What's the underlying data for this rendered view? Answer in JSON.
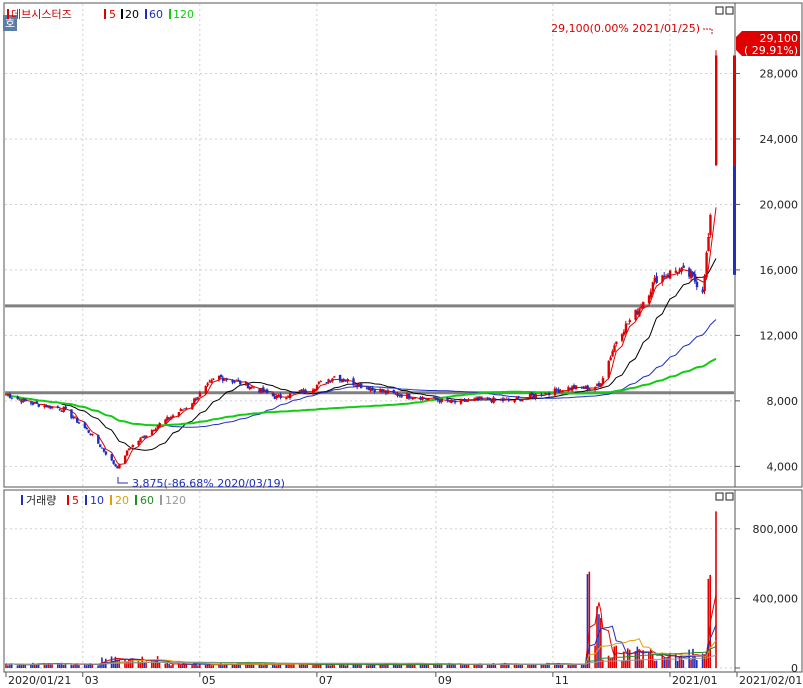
{
  "price_panel": {
    "title": "데브시스터즈",
    "ma_periods": [
      "5",
      "20",
      "60",
      "120"
    ],
    "ma_colors": [
      "#e00000",
      "#000000",
      "#1f2fbf",
      "#11cc11"
    ],
    "side_icon": "expand-icon",
    "max_annotation": "29,100(0.00% 2021/01/25)",
    "min_annotation": "3,875(-86.68% 2020/03/19)",
    "current_price": "29,100",
    "current_change": "( 29.91%)"
  },
  "volume_panel": {
    "title": "거래량",
    "ma_periods": [
      "5",
      "10",
      "20",
      "60",
      "120"
    ],
    "ma_colors": [
      "#e00000",
      "#1f2fbf",
      "#e0a000",
      "#228b22",
      "#999999"
    ]
  },
  "x_axis_labels": [
    "2020/01/21",
    "03",
    "05",
    "07",
    "09",
    "11",
    "2021/01",
    "2021/02/01"
  ],
  "chart_data": [
    {
      "type": "line",
      "title": "데브시스터즈",
      "y_ticks": [
        "4,000",
        "8,000",
        "12,000",
        "16,000",
        "20,000",
        "24,000",
        "28,000"
      ],
      "ylim": [
        2800,
        32000
      ],
      "x_start": "2020/01/21",
      "x_end": "2021/01/25",
      "close_series": {
        "name": "price",
        "dates": [
          "2020/01/21",
          "2020/02/01",
          "2020/02/20",
          "2020/03/05",
          "2020/03/19",
          "2020/03/25",
          "2020/04/10",
          "2020/04/25",
          "2020/05/10",
          "2020/05/25",
          "2020/06/10",
          "2020/06/25",
          "2020/07/10",
          "2020/07/25",
          "2020/08/10",
          "2020/08/25",
          "2020/09/10",
          "2020/09/25",
          "2020/10/10",
          "2020/10/25",
          "2020/11/10",
          "2020/11/20",
          "2020/11/25",
          "2020/12/05",
          "2020/12/15",
          "2020/12/25",
          "2021/01/05",
          "2021/01/12",
          "2021/01/18",
          "2021/01/22",
          "2021/01/25"
        ],
        "values": [
          8400,
          7900,
          7500,
          6000,
          3875,
          5100,
          6600,
          7700,
          9500,
          9000,
          8200,
          8600,
          9500,
          8900,
          8400,
          8200,
          7900,
          8100,
          8000,
          8400,
          8800,
          8800,
          8900,
          12000,
          13500,
          15500,
          16000,
          15600,
          14800,
          19000,
          29100
        ]
      },
      "horizontal_lines": [
        13800,
        8500
      ],
      "annotations": [
        "29,100(0.00% 2021/01/25)",
        "3,875(-86.68% 2020/03/19)"
      ],
      "current_value_label": [
        "29,100",
        "( 29.91%)"
      ]
    },
    {
      "type": "bar",
      "title": "거래량",
      "y_ticks": [
        "0",
        "400,000",
        "800,000"
      ],
      "ylim": [
        0,
        1000000
      ],
      "peaks": [
        {
          "date": "2020/03/20",
          "value": 70000
        },
        {
          "date": "2020/11/20",
          "value": 560000
        },
        {
          "date": "2020/11/25",
          "value": 380000
        },
        {
          "date": "2021/01/22",
          "value": 540000
        },
        {
          "date": "2021/01/25",
          "value": 900000
        }
      ]
    }
  ]
}
